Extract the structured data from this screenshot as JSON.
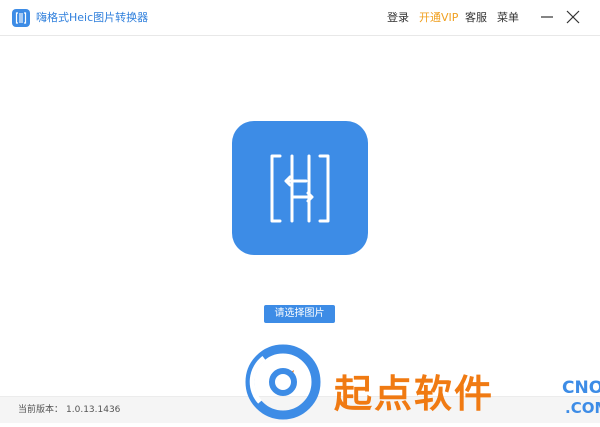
{
  "app": {
    "title": "嗨格式Heic图片转换器",
    "brand_color": "#3d8ce6",
    "logo_icon": "heic-logo-icon"
  },
  "header": {
    "login": "登录",
    "vip": "开通VIP",
    "support": "客服",
    "menu": "菜单",
    "vip_color": "#f0a020",
    "minimize_icon": "minimize-icon",
    "close_icon": "close-icon"
  },
  "main": {
    "hero_icon": "heic-convert-icon",
    "select_button": "请选择图片"
  },
  "footer": {
    "version_label": "当前版本：",
    "version_value": "1.0.13.1436"
  },
  "watermark": {
    "text": "起点软件",
    "domain_top": "CNO",
    "domain_bottom": ".COM",
    "text_color": "#f07a12"
  }
}
